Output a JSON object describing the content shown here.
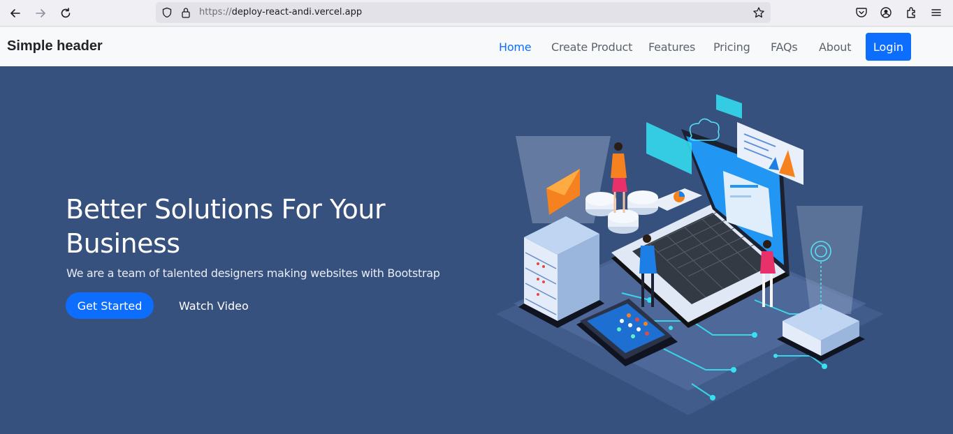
{
  "browser": {
    "url_scheme": "https://",
    "url_host": "deploy-react-andi.vercel.app"
  },
  "header": {
    "brand": "Simple header",
    "nav": [
      "Home",
      "Create Product",
      "Features",
      "Pricing",
      "FAQs",
      "About"
    ],
    "login_label": "Login",
    "accent_color": "#0d6efd"
  },
  "hero": {
    "title": "Better Solutions For Your Business",
    "subtitle": "We are a team of talented designers making websites with Bootstrap",
    "cta_label": "Get Started",
    "secondary_label": "Watch Video",
    "background_color": "#37517e"
  },
  "icons": [
    "back-icon",
    "forward-icon",
    "reload-icon",
    "shield-icon",
    "lock-icon",
    "bookmark-star-icon",
    "pocket-icon",
    "account-icon",
    "extensions-icon",
    "menu-icon"
  ]
}
